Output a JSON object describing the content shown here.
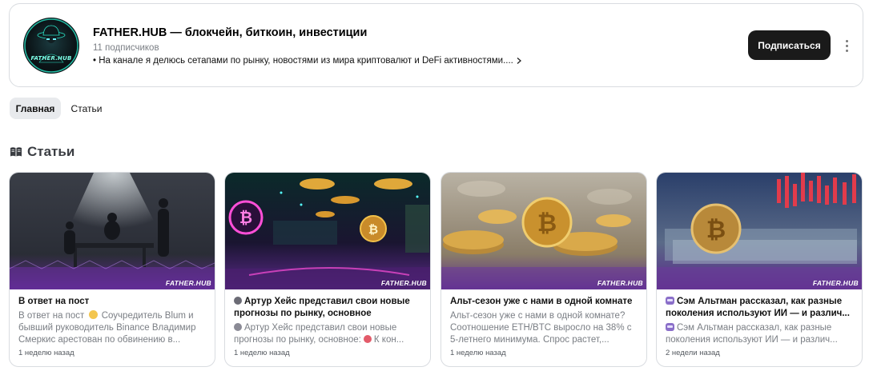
{
  "channel": {
    "avatar_text": "FATHER.HUB",
    "title": "FATHER.HUB — блокчейн, биткоин, инвестиции",
    "subscribers": "11 подписчиков",
    "description": "• На канале я делюсь сетапами по рынку, новостями из мира криптовалют и DeFi активностями....",
    "subscribe_label": "Подписаться"
  },
  "tabs": [
    {
      "label": "Главная",
      "active": true
    },
    {
      "label": "Статьи",
      "active": false
    }
  ],
  "section": {
    "title": "Статьи",
    "icon": "book-icon"
  },
  "articles": [
    {
      "title": "В ответ на пост",
      "excerpt_a": "В ответ на пост",
      "excerpt_b": "Соучредитель Blum и бывший руководитель Binance Владимир Смеркис арестован по обвинению в...",
      "date": "1 неделю назад",
      "watermark": "FATHER.HUB"
    },
    {
      "title": "Артур Хейс представил свои новые прогнозы по рынку, основное",
      "excerpt_a": "Артур Хейс представил свои новые прогнозы по рынку, основное:",
      "excerpt_b": "К кон...",
      "date": "1 неделю назад",
      "watermark": "FATHER.HUB"
    },
    {
      "title": "Альт-сезон уже с нами в одной комнате",
      "excerpt": "Альт-сезон уже с нами в одной комнате? Соотношение ETH/BTC выросло на 38% с 5-летнего минимума. Спрос растет,...",
      "date": "1 неделю назад",
      "watermark": "FATHER.HUB"
    },
    {
      "title": "Сэм Альтман рассказал, как разные поколения используют ИИ — и различ...",
      "excerpt": "Сэм Альтман рассказал, как разные поколения используют ИИ — и различ...",
      "date": "2 недели назад",
      "watermark": "FATHER.HUB"
    }
  ],
  "colors": {
    "button_bg": "#1a1a1a",
    "tab_active_bg": "#e8eaed",
    "card_border": "#d9dce0",
    "muted_text": "#7a7e84",
    "avatar_neon": "#7fffe8"
  }
}
